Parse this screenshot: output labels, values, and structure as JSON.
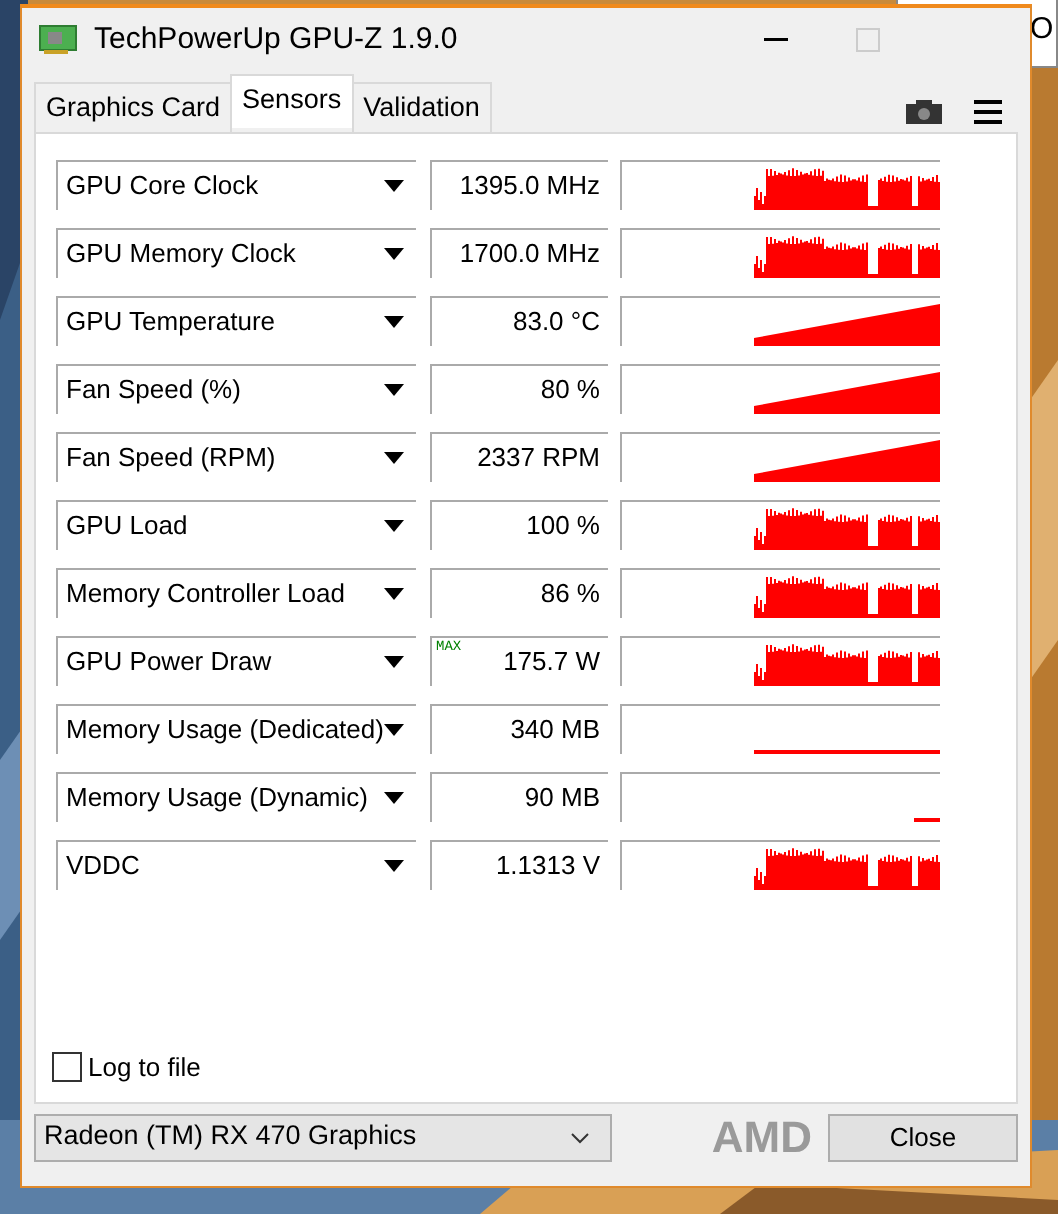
{
  "window": {
    "title": "TechPowerUp GPU-Z 1.9.0"
  },
  "background_window": {
    "text": "O"
  },
  "tabs": [
    {
      "label": "Graphics Card",
      "selected": false
    },
    {
      "label": "Sensors",
      "selected": true
    },
    {
      "label": "Validation",
      "selected": false
    }
  ],
  "sensors": [
    {
      "name": "GPU Core Clock",
      "value": "1395.0 MHz",
      "kind": "burst"
    },
    {
      "name": "GPU Memory Clock",
      "value": "1700.0 MHz",
      "kind": "burst"
    },
    {
      "name": "GPU Temperature",
      "value": "83.0 °C",
      "kind": "ramp"
    },
    {
      "name": "Fan Speed (%)",
      "value": "80 %",
      "kind": "ramp"
    },
    {
      "name": "Fan Speed (RPM)",
      "value": "2337 RPM",
      "kind": "ramp"
    },
    {
      "name": "GPU Load",
      "value": "100 %",
      "kind": "burst"
    },
    {
      "name": "Memory Controller Load",
      "value": "86 %",
      "kind": "burst"
    },
    {
      "name": "GPU Power Draw",
      "value": "175.7 W",
      "badge": "MAX",
      "kind": "burst"
    },
    {
      "name": "Memory Usage (Dedicated)",
      "value": "340 MB",
      "kind": "flatline"
    },
    {
      "name": "Memory Usage (Dynamic)",
      "value": "90 MB",
      "kind": "tail"
    },
    {
      "name": "VDDC",
      "value": "1.1313 V",
      "kind": "burst"
    }
  ],
  "log_to_file": {
    "label": "Log to file",
    "checked": false
  },
  "device_select": {
    "value": "Radeon (TM) RX 470 Graphics"
  },
  "vendor_logo": "AMD",
  "close_button": "Close"
}
